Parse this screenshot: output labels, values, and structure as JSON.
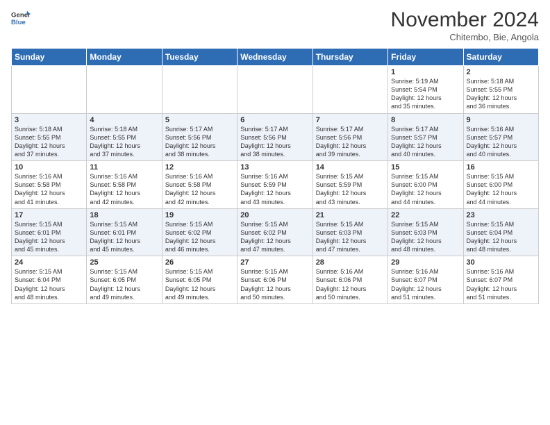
{
  "header": {
    "logo_general": "General",
    "logo_blue": "Blue",
    "month_title": "November 2024",
    "location": "Chitembo, Bie, Angola"
  },
  "weekdays": [
    "Sunday",
    "Monday",
    "Tuesday",
    "Wednesday",
    "Thursday",
    "Friday",
    "Saturday"
  ],
  "weeks": [
    [
      {
        "day": "",
        "info": ""
      },
      {
        "day": "",
        "info": ""
      },
      {
        "day": "",
        "info": ""
      },
      {
        "day": "",
        "info": ""
      },
      {
        "day": "",
        "info": ""
      },
      {
        "day": "1",
        "info": "Sunrise: 5:19 AM\nSunset: 5:54 PM\nDaylight: 12 hours\nand 35 minutes."
      },
      {
        "day": "2",
        "info": "Sunrise: 5:18 AM\nSunset: 5:55 PM\nDaylight: 12 hours\nand 36 minutes."
      }
    ],
    [
      {
        "day": "3",
        "info": "Sunrise: 5:18 AM\nSunset: 5:55 PM\nDaylight: 12 hours\nand 37 minutes."
      },
      {
        "day": "4",
        "info": "Sunrise: 5:18 AM\nSunset: 5:55 PM\nDaylight: 12 hours\nand 37 minutes."
      },
      {
        "day": "5",
        "info": "Sunrise: 5:17 AM\nSunset: 5:56 PM\nDaylight: 12 hours\nand 38 minutes."
      },
      {
        "day": "6",
        "info": "Sunrise: 5:17 AM\nSunset: 5:56 PM\nDaylight: 12 hours\nand 38 minutes."
      },
      {
        "day": "7",
        "info": "Sunrise: 5:17 AM\nSunset: 5:56 PM\nDaylight: 12 hours\nand 39 minutes."
      },
      {
        "day": "8",
        "info": "Sunrise: 5:17 AM\nSunset: 5:57 PM\nDaylight: 12 hours\nand 40 minutes."
      },
      {
        "day": "9",
        "info": "Sunrise: 5:16 AM\nSunset: 5:57 PM\nDaylight: 12 hours\nand 40 minutes."
      }
    ],
    [
      {
        "day": "10",
        "info": "Sunrise: 5:16 AM\nSunset: 5:58 PM\nDaylight: 12 hours\nand 41 minutes."
      },
      {
        "day": "11",
        "info": "Sunrise: 5:16 AM\nSunset: 5:58 PM\nDaylight: 12 hours\nand 42 minutes."
      },
      {
        "day": "12",
        "info": "Sunrise: 5:16 AM\nSunset: 5:58 PM\nDaylight: 12 hours\nand 42 minutes."
      },
      {
        "day": "13",
        "info": "Sunrise: 5:16 AM\nSunset: 5:59 PM\nDaylight: 12 hours\nand 43 minutes."
      },
      {
        "day": "14",
        "info": "Sunrise: 5:15 AM\nSunset: 5:59 PM\nDaylight: 12 hours\nand 43 minutes."
      },
      {
        "day": "15",
        "info": "Sunrise: 5:15 AM\nSunset: 6:00 PM\nDaylight: 12 hours\nand 44 minutes."
      },
      {
        "day": "16",
        "info": "Sunrise: 5:15 AM\nSunset: 6:00 PM\nDaylight: 12 hours\nand 44 minutes."
      }
    ],
    [
      {
        "day": "17",
        "info": "Sunrise: 5:15 AM\nSunset: 6:01 PM\nDaylight: 12 hours\nand 45 minutes."
      },
      {
        "day": "18",
        "info": "Sunrise: 5:15 AM\nSunset: 6:01 PM\nDaylight: 12 hours\nand 45 minutes."
      },
      {
        "day": "19",
        "info": "Sunrise: 5:15 AM\nSunset: 6:02 PM\nDaylight: 12 hours\nand 46 minutes."
      },
      {
        "day": "20",
        "info": "Sunrise: 5:15 AM\nSunset: 6:02 PM\nDaylight: 12 hours\nand 47 minutes."
      },
      {
        "day": "21",
        "info": "Sunrise: 5:15 AM\nSunset: 6:03 PM\nDaylight: 12 hours\nand 47 minutes."
      },
      {
        "day": "22",
        "info": "Sunrise: 5:15 AM\nSunset: 6:03 PM\nDaylight: 12 hours\nand 48 minutes."
      },
      {
        "day": "23",
        "info": "Sunrise: 5:15 AM\nSunset: 6:04 PM\nDaylight: 12 hours\nand 48 minutes."
      }
    ],
    [
      {
        "day": "24",
        "info": "Sunrise: 5:15 AM\nSunset: 6:04 PM\nDaylight: 12 hours\nand 48 minutes."
      },
      {
        "day": "25",
        "info": "Sunrise: 5:15 AM\nSunset: 6:05 PM\nDaylight: 12 hours\nand 49 minutes."
      },
      {
        "day": "26",
        "info": "Sunrise: 5:15 AM\nSunset: 6:05 PM\nDaylight: 12 hours\nand 49 minutes."
      },
      {
        "day": "27",
        "info": "Sunrise: 5:15 AM\nSunset: 6:06 PM\nDaylight: 12 hours\nand 50 minutes."
      },
      {
        "day": "28",
        "info": "Sunrise: 5:16 AM\nSunset: 6:06 PM\nDaylight: 12 hours\nand 50 minutes."
      },
      {
        "day": "29",
        "info": "Sunrise: 5:16 AM\nSunset: 6:07 PM\nDaylight: 12 hours\nand 51 minutes."
      },
      {
        "day": "30",
        "info": "Sunrise: 5:16 AM\nSunset: 6:07 PM\nDaylight: 12 hours\nand 51 minutes."
      }
    ]
  ]
}
